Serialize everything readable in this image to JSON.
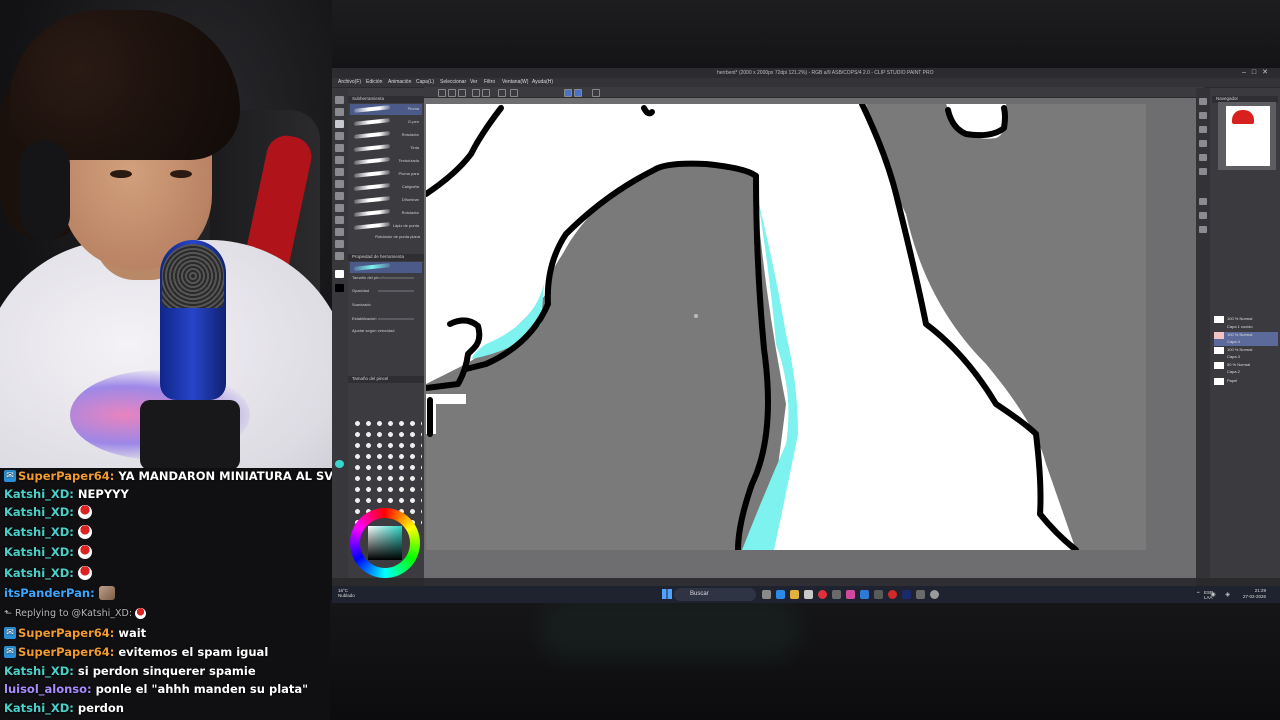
{
  "chat": [
    {
      "user": "SuperPaper64:",
      "text": "YA MANDARON MINIATURA AL SV XDDDD",
      "color": "#f29a2e",
      "badge": "ticket"
    },
    {
      "user": "Katshi_XD:",
      "text": "NEPYYY",
      "color": "#4ad0c8"
    },
    {
      "user": "Katshi_XD:",
      "text": "",
      "color": "#4ad0c8",
      "emote": "mario-emote"
    },
    {
      "user": "Katshi_XD:",
      "text": "",
      "color": "#4ad0c8",
      "emote": "mario-emote"
    },
    {
      "user": "Katshi_XD:",
      "text": "",
      "color": "#4ad0c8",
      "emote": "mario-emote"
    },
    {
      "user": "Katshi_XD:",
      "text": "",
      "color": "#4ad0c8",
      "emote": "mario-emote"
    },
    {
      "user": "itsPanderPan:",
      "text": "",
      "color": "#3aa6ff",
      "emote": "face-emote"
    },
    {
      "reply": "Replying to @Katshi_XD:"
    },
    {
      "user": "SuperPaper64:",
      "text": "wait",
      "color": "#f29a2e",
      "badge": "ticket"
    },
    {
      "user": "SuperPaper64:",
      "text": "evitemos el spam igual",
      "color": "#f29a2e",
      "badge": "ticket"
    },
    {
      "user": "Katshi_XD:",
      "text": "si perdon sinquerer spamie",
      "color": "#4ad0c8"
    },
    {
      "user": "luisol_alonso:",
      "text": "ponle el \"ahhh manden su plata\"",
      "color": "#a98cff"
    },
    {
      "user": "Katshi_XD:",
      "text": "perdon",
      "color": "#4ad0c8"
    }
  ],
  "app": {
    "title": "herrbent* (2000 x 2000px 72dpi 121.2%) - RGB a/9 ASB/COPS/4 2.0 - CLIP STUDIO PAINT PRO",
    "menu": [
      "Archivo(F)",
      "Edición",
      "Animación",
      "Capa(L)",
      "Seleccionar",
      "Ver",
      "Filtro",
      "Ventana(W)",
      "Ayuda(H)"
    ],
    "brush_panel_title": "Subherramienta",
    "brushes": [
      "Pluma",
      "G-pen",
      "Rotulador",
      "Tinta",
      "Texturizada",
      "Pluma para",
      "Caligrafía",
      "Difuminar",
      "Rotulador",
      "Lápiz de punta"
    ],
    "brush_footer": "Rotulador de punta plana",
    "tool_props_title": "Propiedad de herramienta",
    "props": [
      "Tamaño del pincel",
      "Opacidad",
      "Suavizado",
      "Estabilización",
      "Ajustar según velocidad"
    ],
    "brush_size_title": "Tamaño del pincel",
    "navigator_title": "Navegador",
    "layers": [
      {
        "name": "100 % Normal",
        "sub": "Capa 1 cocido"
      },
      {
        "name": "100 % Normal",
        "sub": "Capa 4",
        "selected": true
      },
      {
        "name": "100 % Normal",
        "sub": "Capa 3"
      },
      {
        "name": "50 % Normal",
        "sub": "Capa 2"
      },
      {
        "name": "",
        "sub": "Papel"
      }
    ]
  },
  "taskbar": {
    "weather_temp": "16°C",
    "weather_desc": "Nublado",
    "search_placeholder": "Buscar",
    "lang": "ESP LAA",
    "time": "21:29",
    "date": "27-02-2026"
  },
  "colors": {
    "cyan_fill": "#7ef2ef",
    "canvas_gray": "#7a7a7a",
    "accent_red": "#d8201f"
  }
}
